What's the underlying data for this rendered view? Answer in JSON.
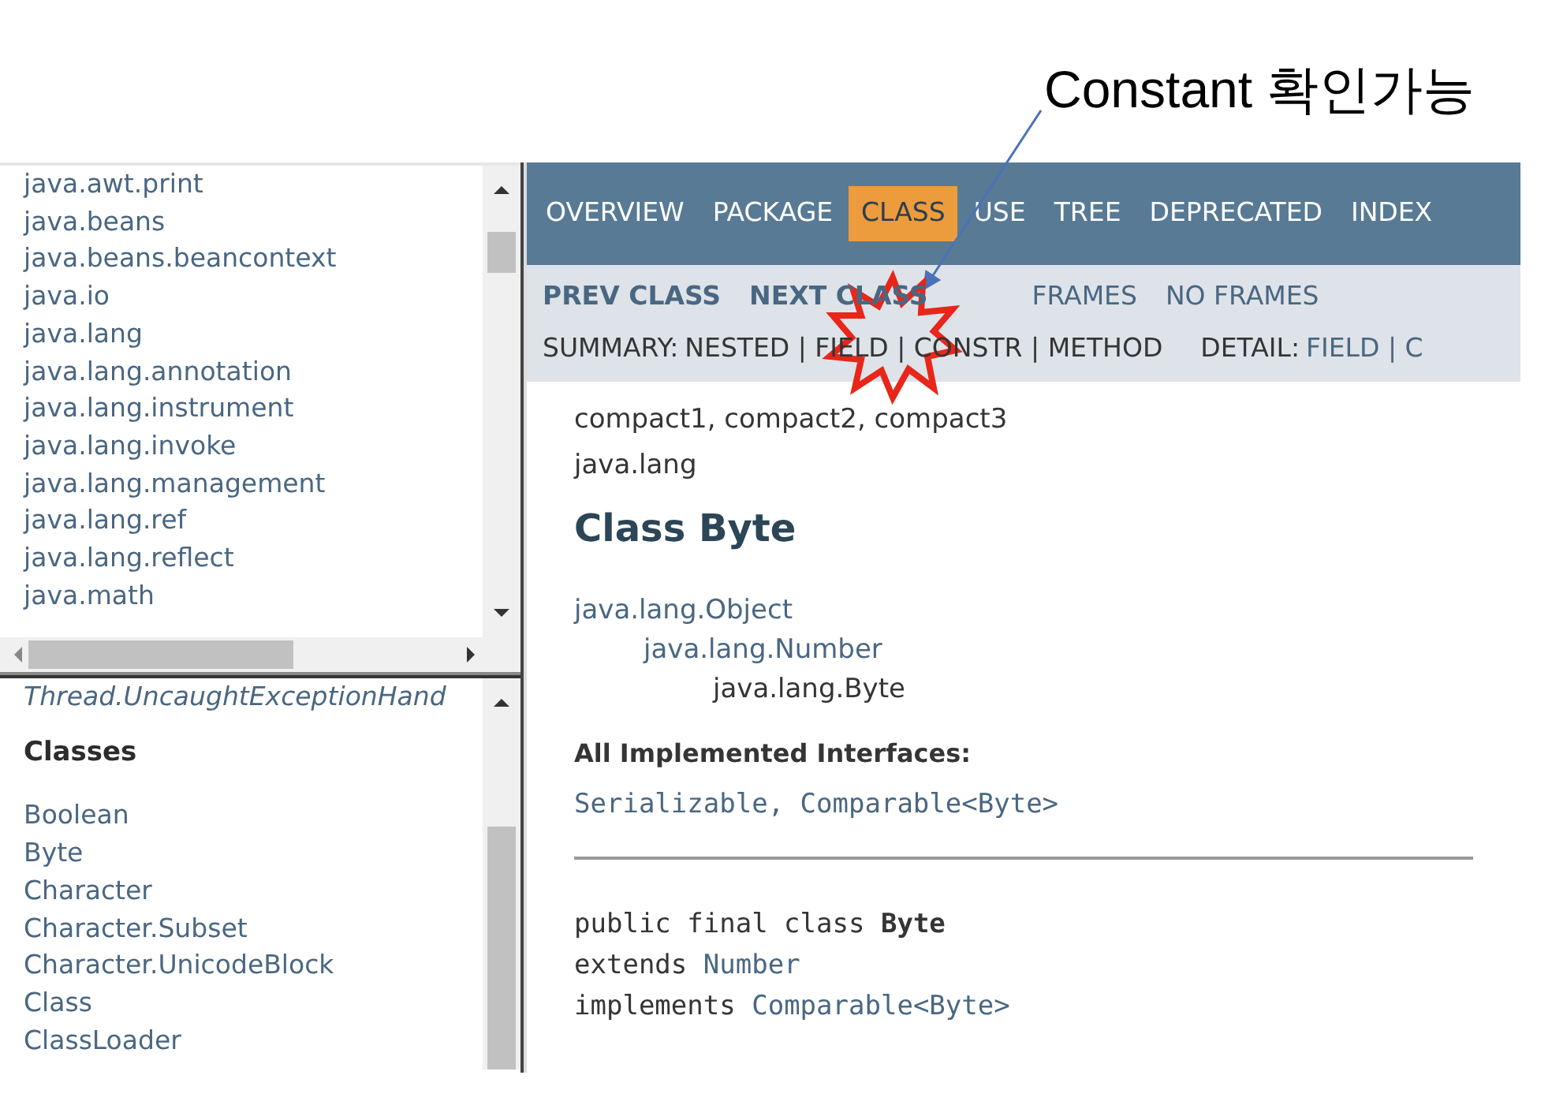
{
  "annotation": {
    "text": "Constant 확인가능"
  },
  "packages": [
    "java.awt.print",
    "java.beans",
    "java.beans.beancontext",
    "java.io",
    "java.lang",
    "java.lang.annotation",
    "java.lang.instrument",
    "java.lang.invoke",
    "java.lang.management",
    "java.lang.ref",
    "java.lang.reflect",
    "java.math"
  ],
  "classes_frame": {
    "cut_item": "Thread.UncaughtExceptionHand",
    "heading": "Classes",
    "items": [
      "Boolean",
      "Byte",
      "Character",
      "Character.Subset",
      "Character.UnicodeBlock",
      "Class",
      "ClassLoader"
    ]
  },
  "navbar": [
    {
      "label": "OVERVIEW",
      "selected": false
    },
    {
      "label": "PACKAGE",
      "selected": false
    },
    {
      "label": "CLASS",
      "selected": true
    },
    {
      "label": "USE",
      "selected": false
    },
    {
      "label": "TREE",
      "selected": false
    },
    {
      "label": "DEPRECATED",
      "selected": false
    },
    {
      "label": "INDEX",
      "selected": false
    }
  ],
  "subnav": {
    "links": [
      "PREV CLASS",
      "NEXT CLASS"
    ],
    "frames": [
      "FRAMES",
      "NO FRAMES"
    ],
    "summary_label": "SUMMARY:",
    "summary": "NESTED | FIELD | CONSTR | METHOD",
    "detail_label": "DETAIL:",
    "detail": "FIELD | C"
  },
  "content": {
    "profiles": "compact1, compact2, compact3",
    "package": "java.lang",
    "title": "Class Byte",
    "inheritance": {
      "name": "java.lang.Object",
      "children": [
        {
          "name": "java.lang.Number",
          "children": [
            {
              "name": "java.lang.Byte"
            }
          ]
        }
      ]
    },
    "interfaces_label": "All Implemented Interfaces:",
    "interfaces": "Serializable, Comparable<Byte>",
    "declaration": [
      [
        {
          "kind": "plain",
          "text": "public final class "
        },
        {
          "kind": "bold",
          "text": "Byte"
        }
      ],
      [
        {
          "kind": "plain",
          "text": "extends "
        },
        {
          "kind": "link",
          "text": "Number"
        }
      ],
      [
        {
          "kind": "plain",
          "text": "implements "
        },
        {
          "kind": "link",
          "text": "Comparable<Byte>"
        }
      ]
    ]
  }
}
